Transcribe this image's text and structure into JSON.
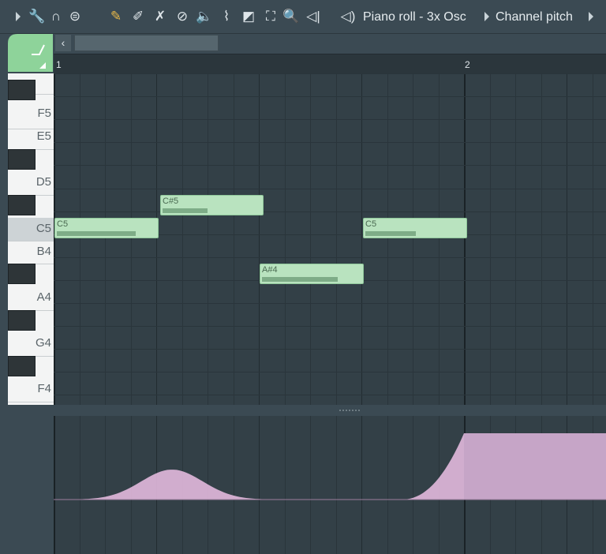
{
  "toolbar": {
    "title": "Piano roll - 3x Osc",
    "target": "Channel pitch",
    "icons": [
      "menu-arrow-icon",
      "wrench-icon",
      "magnet-icon",
      "list-icon",
      "pencil-icon",
      "paint-icon",
      "delete-icon",
      "mute-icon",
      "slice-icon",
      "select-icon",
      "zoom-icon",
      "playback-icon",
      "speaker-icon"
    ]
  },
  "ruler": {
    "bars": [
      "1",
      "2"
    ]
  },
  "keyboard": {
    "labels": {
      "f5": "F5",
      "e5": "E5",
      "d5": "D5",
      "c5": "C5",
      "b4": "B4",
      "a4": "A4",
      "g4": "G4",
      "f4": "F4"
    }
  },
  "notes": [
    {
      "label": "C5",
      "velocity": 0.78
    },
    {
      "label": "C#5",
      "velocity": 0.45
    },
    {
      "label": "A#4",
      "velocity": 0.75
    },
    {
      "label": "C5",
      "velocity": 0.5
    }
  ],
  "colors": {
    "note": "#b9e3bf",
    "event": "#e2b9dd",
    "accent": "#e9b949"
  }
}
